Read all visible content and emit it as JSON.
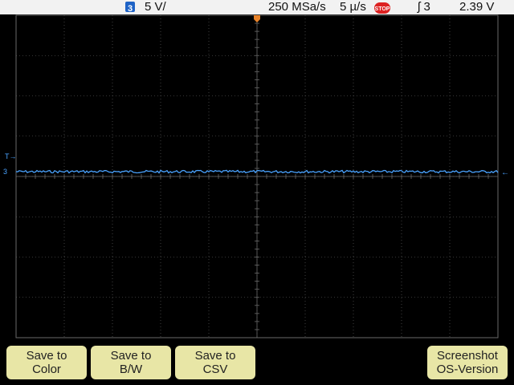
{
  "status": {
    "channel": "3",
    "scale": "5 V/",
    "sample_rate": "250 MSa/s",
    "timebase": "5 µ/s",
    "run_state": "STOP",
    "trigger": "ʃ 3",
    "trigger_level": "2.39  V"
  },
  "markers": {
    "trigger_pos": "T",
    "trigger_level": "T→",
    "channel_ground": "3",
    "right_arrow": "←"
  },
  "softkeys": [
    {
      "line1": "Save to",
      "line2": "Color"
    },
    {
      "line1": "Save to",
      "line2": "B/W"
    },
    {
      "line1": "Save to",
      "line2": "CSV"
    },
    {
      "line1": "Screenshot",
      "line2": "OS-Version"
    }
  ],
  "colors": {
    "trace": "#4aa3ff",
    "grid": "#6a6a6a",
    "softkey": "#e8e6a6",
    "trigger_marker": "#e8832a"
  }
}
